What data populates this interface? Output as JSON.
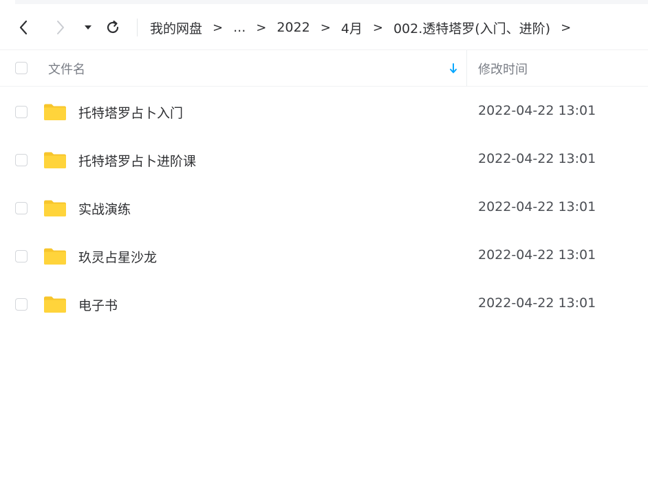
{
  "nav": {
    "back_icon": "chevron-left-icon",
    "forward_icon": "chevron-right-icon",
    "dropdown_icon": "caret-down-icon",
    "refresh_icon": "refresh-icon"
  },
  "breadcrumb": {
    "items": [
      "我的网盘",
      "...",
      "2022",
      "4月",
      "002.透特塔罗(入门、进阶)"
    ],
    "separator": ">"
  },
  "header": {
    "name_label": "文件名",
    "time_label": "修改时间",
    "sort_icon": "sort-down-arrow-icon"
  },
  "files": [
    {
      "name": "托特塔罗占卜入门",
      "modified": "2022-04-22 13:01",
      "icon": "folder-icon"
    },
    {
      "name": "托特塔罗占卜进阶课",
      "modified": "2022-04-22 13:01",
      "icon": "folder-icon"
    },
    {
      "name": "实战演练",
      "modified": "2022-04-22 13:01",
      "icon": "folder-icon"
    },
    {
      "name": "玖灵占星沙龙",
      "modified": "2022-04-22 13:01",
      "icon": "folder-icon"
    },
    {
      "name": "电子书",
      "modified": "2022-04-22 13:01",
      "icon": "folder-icon"
    }
  ],
  "colors": {
    "folder": "#ffd43b",
    "folder_tab": "#f7c52b",
    "sort_arrow": "#06a7ff",
    "text_primary": "#2f3033",
    "text_secondary": "#7a7e86"
  }
}
